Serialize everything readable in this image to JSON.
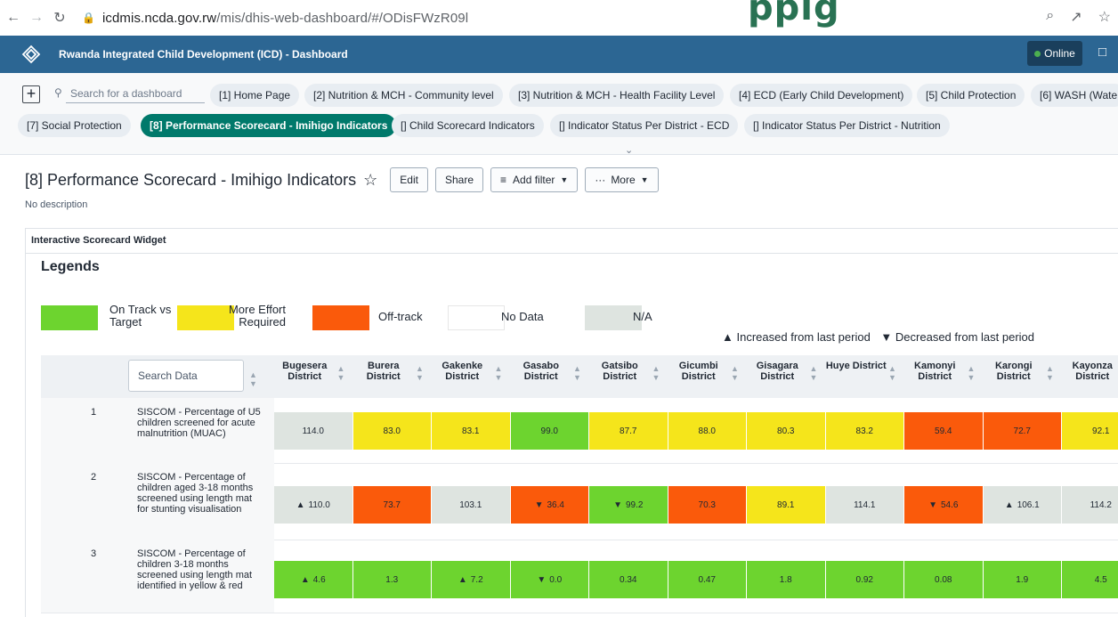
{
  "browser": {
    "url_host": "icdmis.ncda.gov.rw",
    "url_path": "/mis/dhis-web-dashboard/#/ODisFWzR09l",
    "overlay_text": "ppig"
  },
  "header": {
    "app_title": "Rwanda Integrated Child Development (ICD) - Dashboard",
    "status": "Online"
  },
  "dashboards": {
    "search_placeholder": "Search for a dashboard",
    "chips": [
      "[1] Home Page",
      "[2] Nutrition & MCH - Community level",
      "[3] Nutrition & MCH - Health Facility Level",
      "[4] ECD (Early Child Development)",
      "[5] Child Protection",
      "[6] WASH (Wate",
      "[7] Social Protection",
      "[8] Performance Scorecard - Imihigo Indicators",
      "[] Child Scorecard Indicators",
      "[] Indicator Status Per District - ECD",
      "[] Indicator Status Per District - Nutrition"
    ],
    "active_index": 7
  },
  "title_bar": {
    "title": "[8] Performance Scorecard - Imihigo Indicators",
    "edit": "Edit",
    "share": "Share",
    "add_filter": "Add filter",
    "more": "More",
    "description": "No description"
  },
  "widget": {
    "title": "Interactive Scorecard Widget",
    "legends_title": "Legends",
    "legends": [
      {
        "label": "On Track vs Target",
        "color": "#6dd42f"
      },
      {
        "label": "More Effort Required",
        "color": "#f5e51b"
      },
      {
        "label": "Off-track",
        "color": "#fa5a0b"
      },
      {
        "label": "No Data",
        "color": "#ffffff"
      },
      {
        "label": "N/A",
        "color": "#dee4e0"
      }
    ],
    "trend_increased": "Increased from last period",
    "trend_decreased": "Decreased from last period",
    "search_data_placeholder": "Search Data",
    "columns": [
      "Bugesera District",
      "Burera District",
      "Gakenke District",
      "Gasabo District",
      "Gatsibo District",
      "Gicumbi District",
      "Gisagara District",
      "Huye District",
      "Kamonyi District",
      "Karongi District",
      "Kayonza District"
    ],
    "rows": [
      {
        "index": "1",
        "label": "SISCOM - Percentage of U5 children screened for acute malnutrition (MUAC)",
        "cells": [
          {
            "value": "114.0",
            "status": "na",
            "trend": ""
          },
          {
            "value": "83.0",
            "status": "effort",
            "trend": ""
          },
          {
            "value": "83.1",
            "status": "effort",
            "trend": ""
          },
          {
            "value": "99.0",
            "status": "track",
            "trend": ""
          },
          {
            "value": "87.7",
            "status": "effort",
            "trend": ""
          },
          {
            "value": "88.0",
            "status": "effort",
            "trend": ""
          },
          {
            "value": "80.3",
            "status": "effort",
            "trend": ""
          },
          {
            "value": "83.2",
            "status": "effort",
            "trend": ""
          },
          {
            "value": "59.4",
            "status": "off",
            "trend": ""
          },
          {
            "value": "72.7",
            "status": "off",
            "trend": ""
          },
          {
            "value": "92.1",
            "status": "effort",
            "trend": ""
          }
        ]
      },
      {
        "index": "2",
        "label": "SISCOM - Percentage of children aged 3-18 months screened using length mat for stunting visualisation",
        "cells": [
          {
            "value": "110.0",
            "status": "na",
            "trend": "up"
          },
          {
            "value": "73.7",
            "status": "off",
            "trend": ""
          },
          {
            "value": "103.1",
            "status": "na",
            "trend": ""
          },
          {
            "value": "36.4",
            "status": "off",
            "trend": "down"
          },
          {
            "value": "99.2",
            "status": "track",
            "trend": "down"
          },
          {
            "value": "70.3",
            "status": "off",
            "trend": ""
          },
          {
            "value": "89.1",
            "status": "effort",
            "trend": ""
          },
          {
            "value": "114.1",
            "status": "na",
            "trend": ""
          },
          {
            "value": "54.6",
            "status": "off",
            "trend": "down"
          },
          {
            "value": "106.1",
            "status": "na",
            "trend": "up"
          },
          {
            "value": "114.2",
            "status": "na",
            "trend": ""
          }
        ]
      },
      {
        "index": "3",
        "label": "SISCOM - Percentage of children 3-18 months screened using length mat identified in yellow & red",
        "cells": [
          {
            "value": "4.6",
            "status": "track",
            "trend": "up"
          },
          {
            "value": "1.3",
            "status": "track",
            "trend": ""
          },
          {
            "value": "7.2",
            "status": "track",
            "trend": "up"
          },
          {
            "value": "0.0",
            "status": "track",
            "trend": "down"
          },
          {
            "value": "0.34",
            "status": "track",
            "trend": ""
          },
          {
            "value": "0.47",
            "status": "track",
            "trend": ""
          },
          {
            "value": "1.8",
            "status": "track",
            "trend": ""
          },
          {
            "value": "0.92",
            "status": "track",
            "trend": ""
          },
          {
            "value": "0.08",
            "status": "track",
            "trend": ""
          },
          {
            "value": "1.9",
            "status": "track",
            "trend": ""
          },
          {
            "value": "4.5",
            "status": "track",
            "trend": ""
          }
        ]
      }
    ]
  }
}
